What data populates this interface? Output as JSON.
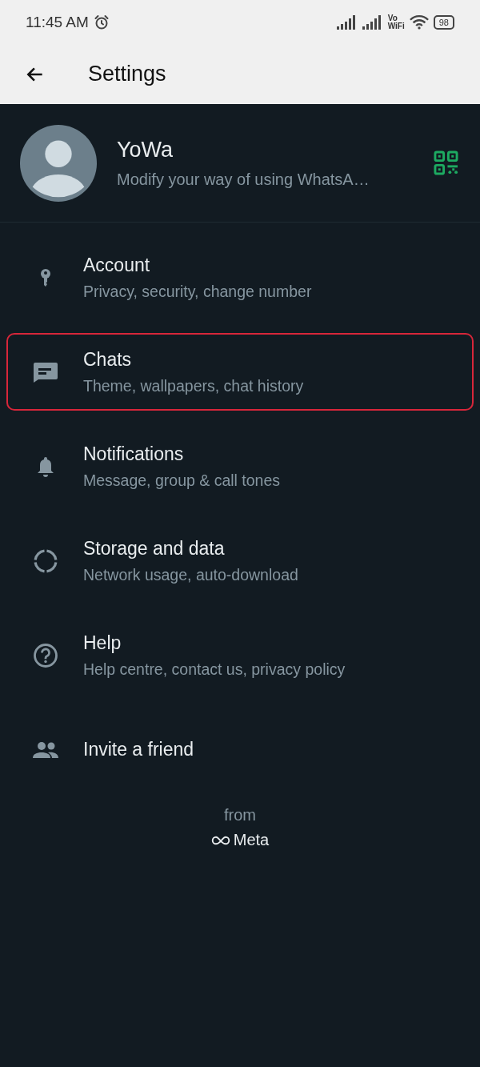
{
  "status_bar": {
    "time": "11:45 AM",
    "network_top": "Vo",
    "network_bottom": "WiFi",
    "battery": "98"
  },
  "header": {
    "title": "Settings"
  },
  "profile": {
    "name": "YoWa",
    "about": "Modify your way of using WhatsA…"
  },
  "items": [
    {
      "kind": "key",
      "title": "Account",
      "subtitle": "Privacy, security, change number",
      "highlighted": false
    },
    {
      "kind": "chat",
      "title": "Chats",
      "subtitle": "Theme, wallpapers, chat history",
      "highlighted": true
    },
    {
      "kind": "bell",
      "title": "Notifications",
      "subtitle": "Message, group & call tones",
      "highlighted": false
    },
    {
      "kind": "storage",
      "title": "Storage and data",
      "subtitle": "Network usage, auto-download",
      "highlighted": false
    },
    {
      "kind": "help",
      "title": "Help",
      "subtitle": "Help centre, contact us, privacy policy",
      "highlighted": false
    },
    {
      "kind": "people",
      "title": "Invite a friend",
      "highlighted": false
    }
  ],
  "footer": {
    "from": "from",
    "brand": "Meta"
  }
}
